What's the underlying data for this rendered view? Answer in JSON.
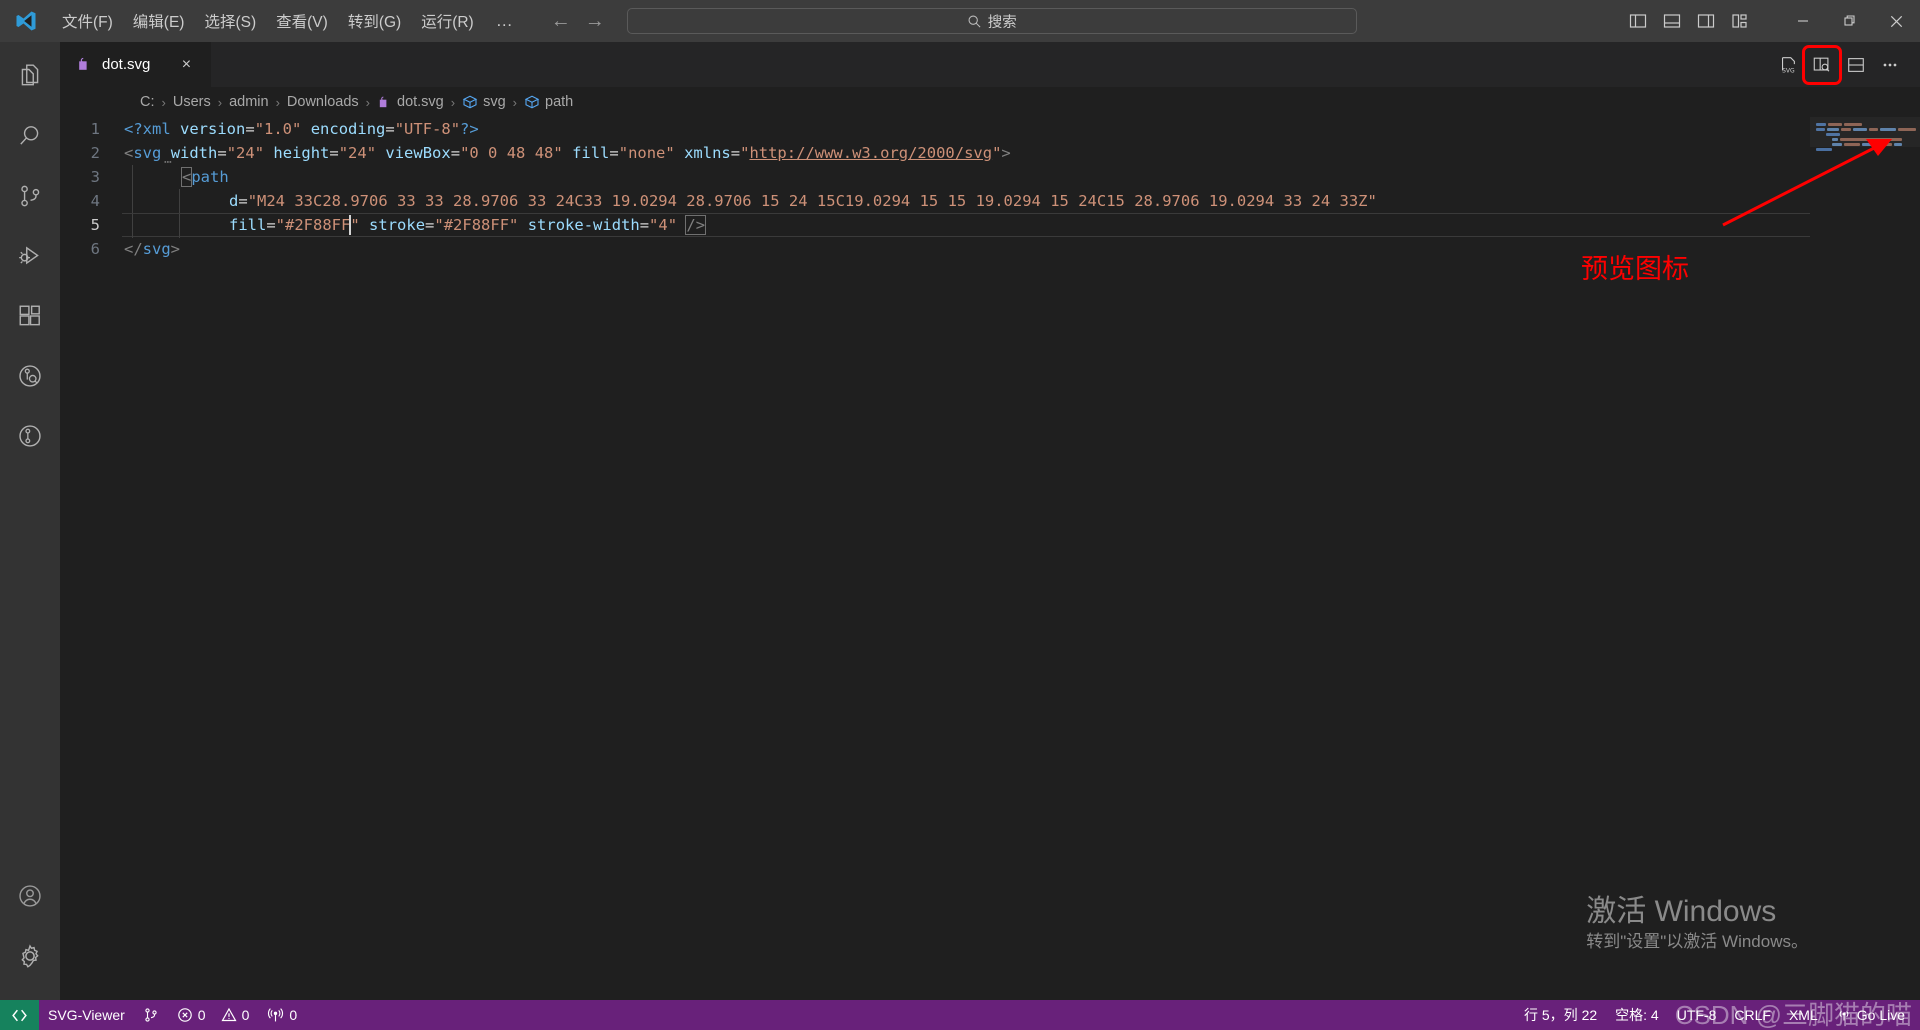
{
  "window": {
    "app_icon": "vscode-logo-icon",
    "menu": [
      {
        "label": "文件(F)",
        "name": "menu-file"
      },
      {
        "label": "编辑(E)",
        "name": "menu-edit"
      },
      {
        "label": "选择(S)",
        "name": "menu-selection"
      },
      {
        "label": "查看(V)",
        "name": "menu-view"
      },
      {
        "label": "转到(G)",
        "name": "menu-go"
      },
      {
        "label": "运行(R)",
        "name": "menu-run"
      }
    ],
    "menu_overflow": "…",
    "nav_back": "←",
    "nav_forward": "→",
    "search": {
      "placeholder": "搜索",
      "value": "",
      "icon": "search-icon"
    },
    "layout_icons": [
      "toggle-primary-sidebar-icon",
      "toggle-panel-icon",
      "toggle-secondary-sidebar-icon",
      "customize-layout-icon"
    ],
    "controls": {
      "minimize": "minimize-icon",
      "restore": "restore-icon",
      "close": "close-icon"
    }
  },
  "activitybar": {
    "items": [
      {
        "name": "explorer",
        "icon": "files-icon"
      },
      {
        "name": "search",
        "icon": "search-icon"
      },
      {
        "name": "source-control",
        "icon": "source-control-icon"
      },
      {
        "name": "run-and-debug",
        "icon": "run-debug-icon"
      },
      {
        "name": "extensions",
        "icon": "extensions-icon"
      },
      {
        "name": "gitlens-inspect",
        "icon": "gitlens-inspect-icon"
      },
      {
        "name": "gitlens",
        "icon": "gitlens-icon"
      }
    ],
    "bottom": [
      {
        "name": "accounts",
        "icon": "account-icon"
      },
      {
        "name": "manage",
        "icon": "gear-icon"
      }
    ]
  },
  "tabs": [
    {
      "label": "dot.svg",
      "icon": "svg-file-icon",
      "active": true,
      "close": "×"
    }
  ],
  "editor_actions": {
    "svg_export": "svg-icon",
    "preview": "open-preview-to-the-side-icon",
    "split_editor": "split-editor-down-icon",
    "more": "more-actions-icon"
  },
  "breadcrumbs": [
    {
      "label": "C:",
      "icon": ""
    },
    {
      "label": "Users",
      "icon": ""
    },
    {
      "label": "admin",
      "icon": ""
    },
    {
      "label": "Downloads",
      "icon": ""
    },
    {
      "label": "dot.svg",
      "icon": "svg-file-icon"
    },
    {
      "label": "svg",
      "icon": "symbol-cube-icon"
    },
    {
      "label": "path",
      "icon": "symbol-cube-icon"
    }
  ],
  "breadcrumb_separator": "›",
  "code": {
    "language": "XML",
    "lines": [
      {
        "n": "1"
      },
      {
        "n": "2"
      },
      {
        "n": "3"
      },
      {
        "n": "4"
      },
      {
        "n": "5"
      },
      {
        "n": "6"
      }
    ],
    "line1": {
      "pi_open": "<?xml",
      "attr1": "version",
      "val1": "\"1.0\"",
      "attr2": "encoding",
      "val2": "\"UTF-8\"",
      "pi_close": "?>"
    },
    "line2": {
      "lt": "<",
      "tag": "svg",
      "a_width": "width",
      "v_width": "\"24\"",
      "a_height": "height",
      "v_height": "\"24\"",
      "a_viewbox": "viewBox",
      "v_viewbox": "\"0 0 48 48\"",
      "a_fill": "fill",
      "v_fill": "\"none\"",
      "a_xmlns": "xmlns",
      "v_xmlns_open": "\"",
      "v_xmlns_url": "http://www.w3.org/2000/svg",
      "v_xmlns_close": "\"",
      "gt": ">"
    },
    "line3": {
      "lt": "<",
      "tag": "path"
    },
    "line4": {
      "attr": "d",
      "eq": "=",
      "value": "\"M24 33C28.9706 33 33 28.9706 33 24C33 19.0294 28.9706 15 24 15C19.0294 15 15 19.0294 15 24C15 28.9706 19.0294 33 24 33Z\""
    },
    "line5": {
      "a_fill": "fill",
      "v_fill_open": "\"",
      "v_fill": "#2F88FF",
      "v_fill_close": "\"",
      "a_stroke": "stroke",
      "v_stroke": "\"#2F88FF\"",
      "a_strokewidth": "stroke-width",
      "v_strokewidth": "\"4\"",
      "selfclose": "/>"
    },
    "line6": {
      "lt": "</",
      "tag": "svg",
      "gt": ">"
    },
    "fold_dots": "⋯"
  },
  "annotation": {
    "label": "预览图标",
    "color": "#ff0000",
    "arrow": "arrow-pointing-to-preview-icon",
    "box": "highlight-box-around-preview-icon"
  },
  "watermarks": {
    "windows_title": "激活 Windows",
    "windows_subtitle": "转到\"设置\"以激活 Windows。",
    "csdn": "CSDN @三脚猫的喵"
  },
  "statusbar": {
    "remote_icon": "remote-window-icon",
    "left": [
      {
        "name": "svg-viewer",
        "label": "SVG-Viewer",
        "icon": ""
      },
      {
        "name": "git-branch",
        "label": "",
        "icon": "source-control-icon"
      },
      {
        "name": "problems-errors",
        "label": "0",
        "icon": "error-icon"
      },
      {
        "name": "problems-warnings",
        "label": "0",
        "icon": "warning-icon"
      },
      {
        "name": "ports",
        "label": "0",
        "icon": "radio-tower-icon"
      }
    ],
    "right": [
      {
        "name": "cursor-position",
        "label": "行 5，列 22"
      },
      {
        "name": "indentation",
        "label": "空格: 4"
      },
      {
        "name": "encoding",
        "label": "UTF-8"
      },
      {
        "name": "eol",
        "label": "CRLF"
      },
      {
        "name": "language-mode",
        "label": "XML"
      },
      {
        "name": "go-live",
        "label": "Go Live",
        "icon": "broadcast-icon"
      }
    ]
  }
}
